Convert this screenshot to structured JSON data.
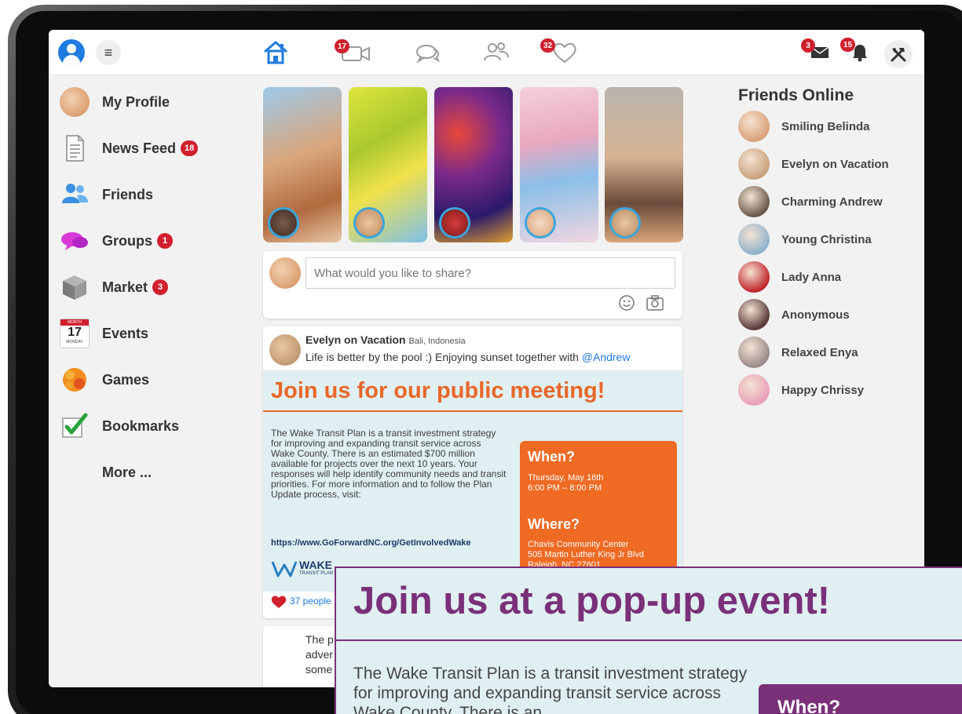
{
  "topbar": {
    "video_badge": "17",
    "likes_badge": "32",
    "mail_badge": "3",
    "bell_badge": "15"
  },
  "sidebar": {
    "items": [
      {
        "label": "My Profile",
        "badge": ""
      },
      {
        "label": "News Feed",
        "badge": "18"
      },
      {
        "label": "Friends",
        "badge": ""
      },
      {
        "label": "Groups",
        "badge": "1"
      },
      {
        "label": "Market",
        "badge": "3"
      },
      {
        "label": "Events",
        "badge": ""
      },
      {
        "label": "Games",
        "badge": ""
      },
      {
        "label": "Bookmarks",
        "badge": ""
      },
      {
        "label": "More ...",
        "badge": ""
      }
    ],
    "calendar_month": "MONTH",
    "calendar_day": "17",
    "calendar_weekday": "MONDAY"
  },
  "composer": {
    "placeholder": "What would you like to share?"
  },
  "post": {
    "author": "Evelyn on Vacation",
    "location": "Bali, Indonesia",
    "text": "Life is better by the pool :) Enjoying sunset together with",
    "mention": "@Andrew",
    "poster": {
      "title": "Join us for our public meeting!",
      "body": "The Wake Transit Plan is a transit investment strategy for improving and expanding transit service across Wake County. There is an estimated $700 million available for projects over the next 10 years. Your responses will help identify community needs and transit priorities. For more information and to follow the Plan Update process, visit:",
      "link": "https://www.GoForwardNC.org/GetInvolvedWake",
      "when_heading": "When?",
      "when_date": "Thursday, May 16th",
      "when_time": "6:00 PM – 8:00 PM",
      "where_heading": "Where?",
      "where_place": "Chavis Community Center",
      "where_street": "505 Martin Luther King Jr Blvd",
      "where_city": "Raleigh, NC 27601",
      "logo_text": "WAKE",
      "logo_sub": "TRANSIT PLAN"
    },
    "likes_text": "37 people"
  },
  "second_post": {
    "line1": "The p",
    "line2": "adver",
    "line3": "some"
  },
  "friends_online": {
    "title": "Friends Online",
    "friends": [
      {
        "name": "Smiling Belinda",
        "color": "#d9a27a"
      },
      {
        "name": "Evelyn on Vacation",
        "color": "#c8a27e"
      },
      {
        "name": "Charming Andrew",
        "color": "#6b5a4a"
      },
      {
        "name": "Young Christina",
        "color": "#8fb3cc"
      },
      {
        "name": "Lady Anna",
        "color": "#c0272d"
      },
      {
        "name": "Anonymous",
        "color": "#5a3a3a"
      },
      {
        "name": "Relaxed Enya",
        "color": "#9a8a8a"
      },
      {
        "name": "Happy Chrissy",
        "color": "#e8a0b8"
      }
    ]
  },
  "overlay": {
    "title": "Join us at a pop-up event!",
    "body": "The Wake Transit Plan is a transit investment strategy for improving and expanding transit service across Wake County. There is an",
    "when_heading": "When?"
  },
  "colors": {
    "accent_blue": "#1f7be0",
    "badge_red": "#d0202e",
    "poster_orange": "#ef6a22",
    "overlay_purple": "#7a3079"
  }
}
